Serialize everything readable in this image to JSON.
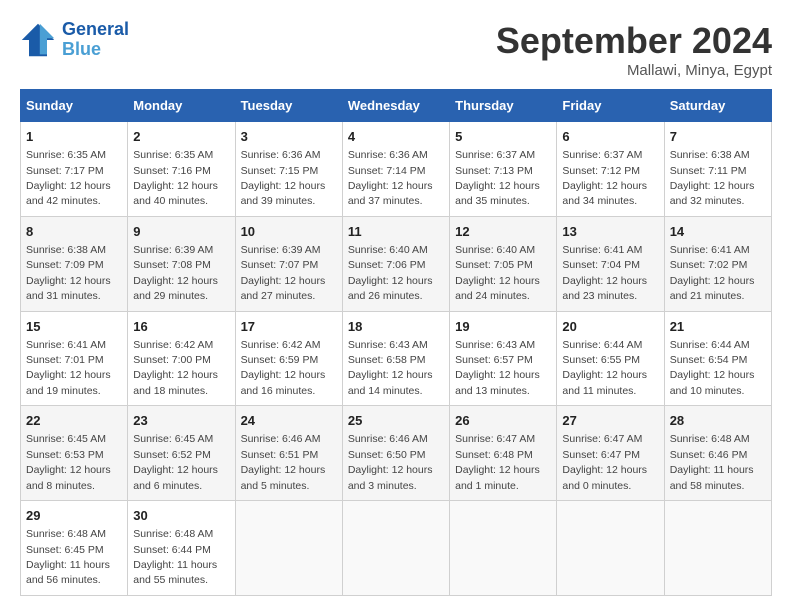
{
  "header": {
    "logo_line1": "General",
    "logo_line2": "Blue",
    "month": "September 2024",
    "location": "Mallawi, Minya, Egypt"
  },
  "weekdays": [
    "Sunday",
    "Monday",
    "Tuesday",
    "Wednesday",
    "Thursday",
    "Friday",
    "Saturday"
  ],
  "weeks": [
    [
      {
        "day": "1",
        "sunrise": "6:35 AM",
        "sunset": "7:17 PM",
        "daylight": "12 hours and 42 minutes."
      },
      {
        "day": "2",
        "sunrise": "6:35 AM",
        "sunset": "7:16 PM",
        "daylight": "12 hours and 40 minutes."
      },
      {
        "day": "3",
        "sunrise": "6:36 AM",
        "sunset": "7:15 PM",
        "daylight": "12 hours and 39 minutes."
      },
      {
        "day": "4",
        "sunrise": "6:36 AM",
        "sunset": "7:14 PM",
        "daylight": "12 hours and 37 minutes."
      },
      {
        "day": "5",
        "sunrise": "6:37 AM",
        "sunset": "7:13 PM",
        "daylight": "12 hours and 35 minutes."
      },
      {
        "day": "6",
        "sunrise": "6:37 AM",
        "sunset": "7:12 PM",
        "daylight": "12 hours and 34 minutes."
      },
      {
        "day": "7",
        "sunrise": "6:38 AM",
        "sunset": "7:11 PM",
        "daylight": "12 hours and 32 minutes."
      }
    ],
    [
      {
        "day": "8",
        "sunrise": "6:38 AM",
        "sunset": "7:09 PM",
        "daylight": "12 hours and 31 minutes."
      },
      {
        "day": "9",
        "sunrise": "6:39 AM",
        "sunset": "7:08 PM",
        "daylight": "12 hours and 29 minutes."
      },
      {
        "day": "10",
        "sunrise": "6:39 AM",
        "sunset": "7:07 PM",
        "daylight": "12 hours and 27 minutes."
      },
      {
        "day": "11",
        "sunrise": "6:40 AM",
        "sunset": "7:06 PM",
        "daylight": "12 hours and 26 minutes."
      },
      {
        "day": "12",
        "sunrise": "6:40 AM",
        "sunset": "7:05 PM",
        "daylight": "12 hours and 24 minutes."
      },
      {
        "day": "13",
        "sunrise": "6:41 AM",
        "sunset": "7:04 PM",
        "daylight": "12 hours and 23 minutes."
      },
      {
        "day": "14",
        "sunrise": "6:41 AM",
        "sunset": "7:02 PM",
        "daylight": "12 hours and 21 minutes."
      }
    ],
    [
      {
        "day": "15",
        "sunrise": "6:41 AM",
        "sunset": "7:01 PM",
        "daylight": "12 hours and 19 minutes."
      },
      {
        "day": "16",
        "sunrise": "6:42 AM",
        "sunset": "7:00 PM",
        "daylight": "12 hours and 18 minutes."
      },
      {
        "day": "17",
        "sunrise": "6:42 AM",
        "sunset": "6:59 PM",
        "daylight": "12 hours and 16 minutes."
      },
      {
        "day": "18",
        "sunrise": "6:43 AM",
        "sunset": "6:58 PM",
        "daylight": "12 hours and 14 minutes."
      },
      {
        "day": "19",
        "sunrise": "6:43 AM",
        "sunset": "6:57 PM",
        "daylight": "12 hours and 13 minutes."
      },
      {
        "day": "20",
        "sunrise": "6:44 AM",
        "sunset": "6:55 PM",
        "daylight": "12 hours and 11 minutes."
      },
      {
        "day": "21",
        "sunrise": "6:44 AM",
        "sunset": "6:54 PM",
        "daylight": "12 hours and 10 minutes."
      }
    ],
    [
      {
        "day": "22",
        "sunrise": "6:45 AM",
        "sunset": "6:53 PM",
        "daylight": "12 hours and 8 minutes."
      },
      {
        "day": "23",
        "sunrise": "6:45 AM",
        "sunset": "6:52 PM",
        "daylight": "12 hours and 6 minutes."
      },
      {
        "day": "24",
        "sunrise": "6:46 AM",
        "sunset": "6:51 PM",
        "daylight": "12 hours and 5 minutes."
      },
      {
        "day": "25",
        "sunrise": "6:46 AM",
        "sunset": "6:50 PM",
        "daylight": "12 hours and 3 minutes."
      },
      {
        "day": "26",
        "sunrise": "6:47 AM",
        "sunset": "6:48 PM",
        "daylight": "12 hours and 1 minute."
      },
      {
        "day": "27",
        "sunrise": "6:47 AM",
        "sunset": "6:47 PM",
        "daylight": "12 hours and 0 minutes."
      },
      {
        "day": "28",
        "sunrise": "6:48 AM",
        "sunset": "6:46 PM",
        "daylight": "11 hours and 58 minutes."
      }
    ],
    [
      {
        "day": "29",
        "sunrise": "6:48 AM",
        "sunset": "6:45 PM",
        "daylight": "11 hours and 56 minutes."
      },
      {
        "day": "30",
        "sunrise": "6:48 AM",
        "sunset": "6:44 PM",
        "daylight": "11 hours and 55 minutes."
      },
      null,
      null,
      null,
      null,
      null
    ]
  ]
}
